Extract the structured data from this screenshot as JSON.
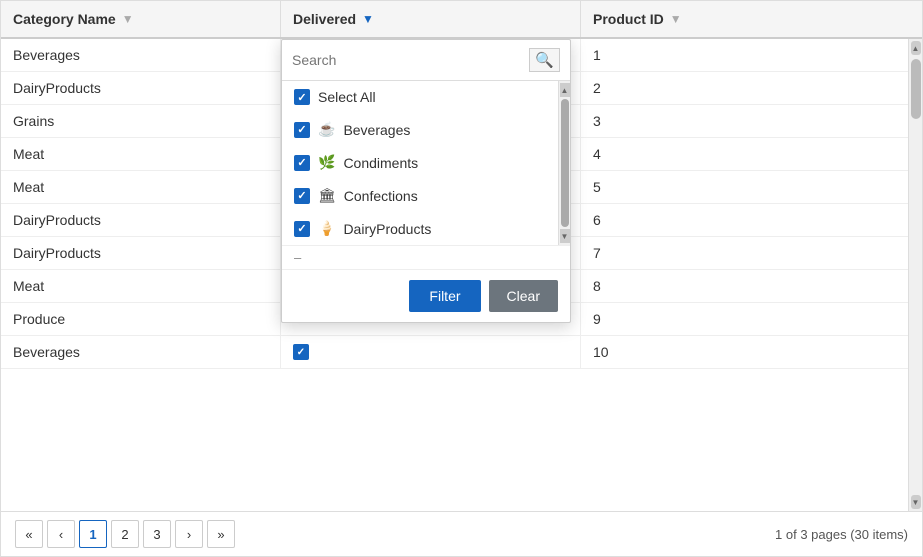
{
  "table": {
    "columns": [
      {
        "key": "category",
        "label": "Category Name",
        "hasFilter": true,
        "filterActive": false
      },
      {
        "key": "delivered",
        "label": "Delivered",
        "hasFilter": true,
        "filterActive": true
      },
      {
        "key": "productId",
        "label": "Product ID",
        "hasFilter": true,
        "filterActive": false
      }
    ],
    "rows": [
      {
        "category": "Beverages",
        "delivered": "",
        "productId": "1"
      },
      {
        "category": "DairyProducts",
        "delivered": "",
        "productId": "2"
      },
      {
        "category": "Grains",
        "delivered": "",
        "productId": "3"
      },
      {
        "category": "Meat",
        "delivered": "",
        "productId": "4"
      },
      {
        "category": "Meat",
        "delivered": "",
        "productId": "5"
      },
      {
        "category": "DairyProducts",
        "delivered": "",
        "productId": "6"
      },
      {
        "category": "DairyProducts",
        "delivered": "",
        "productId": "7"
      },
      {
        "category": "Meat",
        "delivered": "",
        "productId": "8"
      },
      {
        "category": "Produce",
        "delivered": "",
        "productId": "9"
      },
      {
        "category": "Beverages",
        "delivered": "checked",
        "productId": "10"
      }
    ]
  },
  "dropdown": {
    "searchPlaceholder": "Search",
    "items": [
      {
        "label": "Select All",
        "checked": true,
        "icon": ""
      },
      {
        "label": "Beverages",
        "checked": true,
        "icon": "☕"
      },
      {
        "label": "Condiments",
        "checked": true,
        "icon": "🌿"
      },
      {
        "label": "Confections",
        "checked": true,
        "icon": "🏛"
      },
      {
        "label": "DairyProducts",
        "checked": true,
        "icon": "🍦"
      }
    ],
    "footerText": "–",
    "filterButton": "Filter",
    "clearButton": "Clear"
  },
  "pagination": {
    "pages": [
      "1",
      "2",
      "3"
    ],
    "activePage": "1",
    "firstLabel": "«",
    "prevLabel": "‹",
    "nextLabel": "›",
    "lastLabel": "»",
    "info": "1 of 3 pages (30 items)"
  },
  "colors": {
    "accent": "#1565c0",
    "filterActive": "#1565c0",
    "filterInactive": "#aaa",
    "clearBtn": "#6c757d"
  }
}
